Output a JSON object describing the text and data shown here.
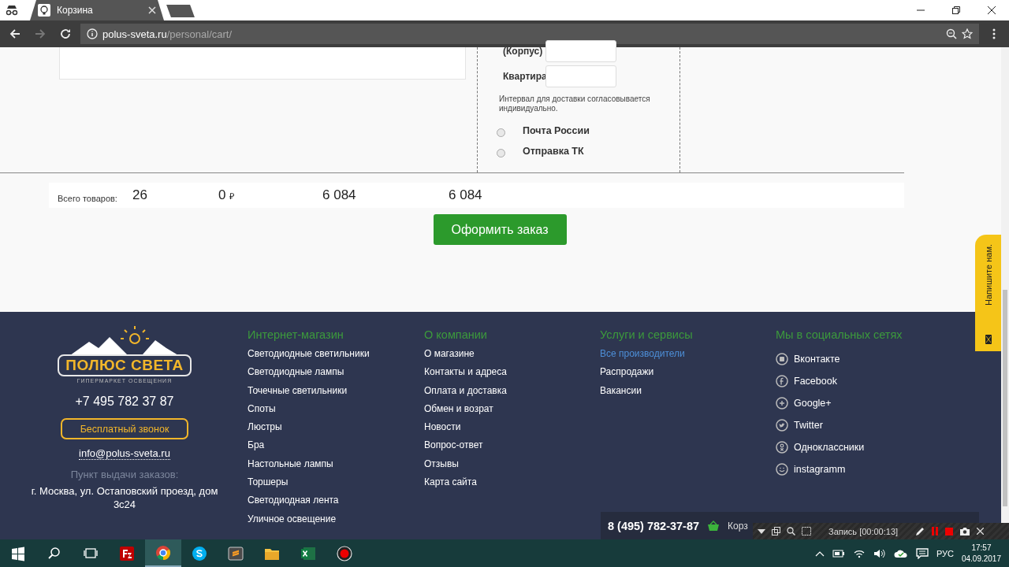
{
  "browser": {
    "tab_title": "Корзина",
    "url_host": "polus-sveta.ru",
    "url_path": "/personal/cart/"
  },
  "delivery": {
    "fields": [
      {
        "label": "(Корпус)"
      },
      {
        "label": "Квартира"
      }
    ],
    "note": "Интервал для доставки согласовывается индивидуально.",
    "options": [
      {
        "label": "Почта России",
        "selected": false
      },
      {
        "label": "Отправка ТК",
        "selected": false
      }
    ]
  },
  "totals": {
    "label": "Всего товаров:",
    "count": "26",
    "discount": "0",
    "currency": "₽",
    "sum": "6 084",
    "total": "6 084"
  },
  "checkout_button": "Оформить заказ",
  "footer": {
    "logo": {
      "name": "ПОЛЮС СВЕТА",
      "tagline": "ГИПЕРМАРКЕТ ОСВЕЩЕНИЯ"
    },
    "phone": "+7 495 782 37 87",
    "callback_button": "Бесплатный звонок",
    "email": "info@polus-sveta.ru",
    "pickup_title": "Пункт выдачи заказов:",
    "pickup_address": "г. Москва, ул. Остаповский проезд, дом 3с24",
    "columns": [
      {
        "title": "Интернет-магазин",
        "links": [
          {
            "label": "Светодиодные светильники",
            "hovered": false
          },
          {
            "label": "Светодиодные лампы",
            "hovered": false
          },
          {
            "label": "Точечные светильники",
            "hovered": false
          },
          {
            "label": "Споты",
            "hovered": false
          },
          {
            "label": "Люстры",
            "hovered": false
          },
          {
            "label": "Бра",
            "hovered": false
          },
          {
            "label": "Настольные лампы",
            "hovered": false
          },
          {
            "label": "Торшеры",
            "hovered": false
          },
          {
            "label": "Светодиодная лента",
            "hovered": false
          },
          {
            "label": "Уличное освещение",
            "hovered": false
          }
        ]
      },
      {
        "title": "О компании",
        "links": [
          {
            "label": "О магазине",
            "hovered": false
          },
          {
            "label": "Контакты и адреса",
            "hovered": false
          },
          {
            "label": "Оплата и доставка",
            "hovered": false
          },
          {
            "label": "Обмен и возрат",
            "hovered": false
          },
          {
            "label": "Новости",
            "hovered": false
          },
          {
            "label": "Вопрос-ответ",
            "hovered": false
          },
          {
            "label": "Отзывы",
            "hovered": false
          },
          {
            "label": "Карта сайта",
            "hovered": false
          }
        ]
      },
      {
        "title": "Услуги и сервисы",
        "links": [
          {
            "label": "Все производители",
            "hovered": true
          },
          {
            "label": "Распродажи",
            "hovered": false
          },
          {
            "label": "Вакансии",
            "hovered": false
          }
        ]
      }
    ],
    "social": {
      "title": "Мы в социальных сетях",
      "links": [
        {
          "kind": "vk",
          "label": "Вконтакте"
        },
        {
          "kind": "facebook",
          "label": "Facebook"
        },
        {
          "kind": "google",
          "label": "Google+"
        },
        {
          "kind": "twitter",
          "label": "Twitter"
        },
        {
          "kind": "ok",
          "label": "Одноклассники"
        },
        {
          "kind": "instagram",
          "label": "instagramm"
        }
      ]
    }
  },
  "feedback_tab": "Напишите нам.",
  "sticky_bar": {
    "phone": "8 (495) 782-37-87",
    "cart": "Корз"
  },
  "recorder": {
    "status": "Запись [00:00:13]"
  },
  "taskbar": {
    "apps": [
      {
        "kind": "start",
        "active": false
      },
      {
        "kind": "search",
        "active": false
      },
      {
        "kind": "taskview",
        "active": false
      },
      {
        "kind": "filezilla",
        "active": false
      },
      {
        "kind": "chrome",
        "active": true
      },
      {
        "kind": "skype",
        "active": false
      },
      {
        "kind": "sublime",
        "active": false
      },
      {
        "kind": "folder",
        "active": false
      },
      {
        "kind": "excel",
        "active": false
      },
      {
        "kind": "recorder",
        "active": false
      }
    ],
    "language": "РУС",
    "time": "17:57",
    "date": "04.09.2017"
  }
}
